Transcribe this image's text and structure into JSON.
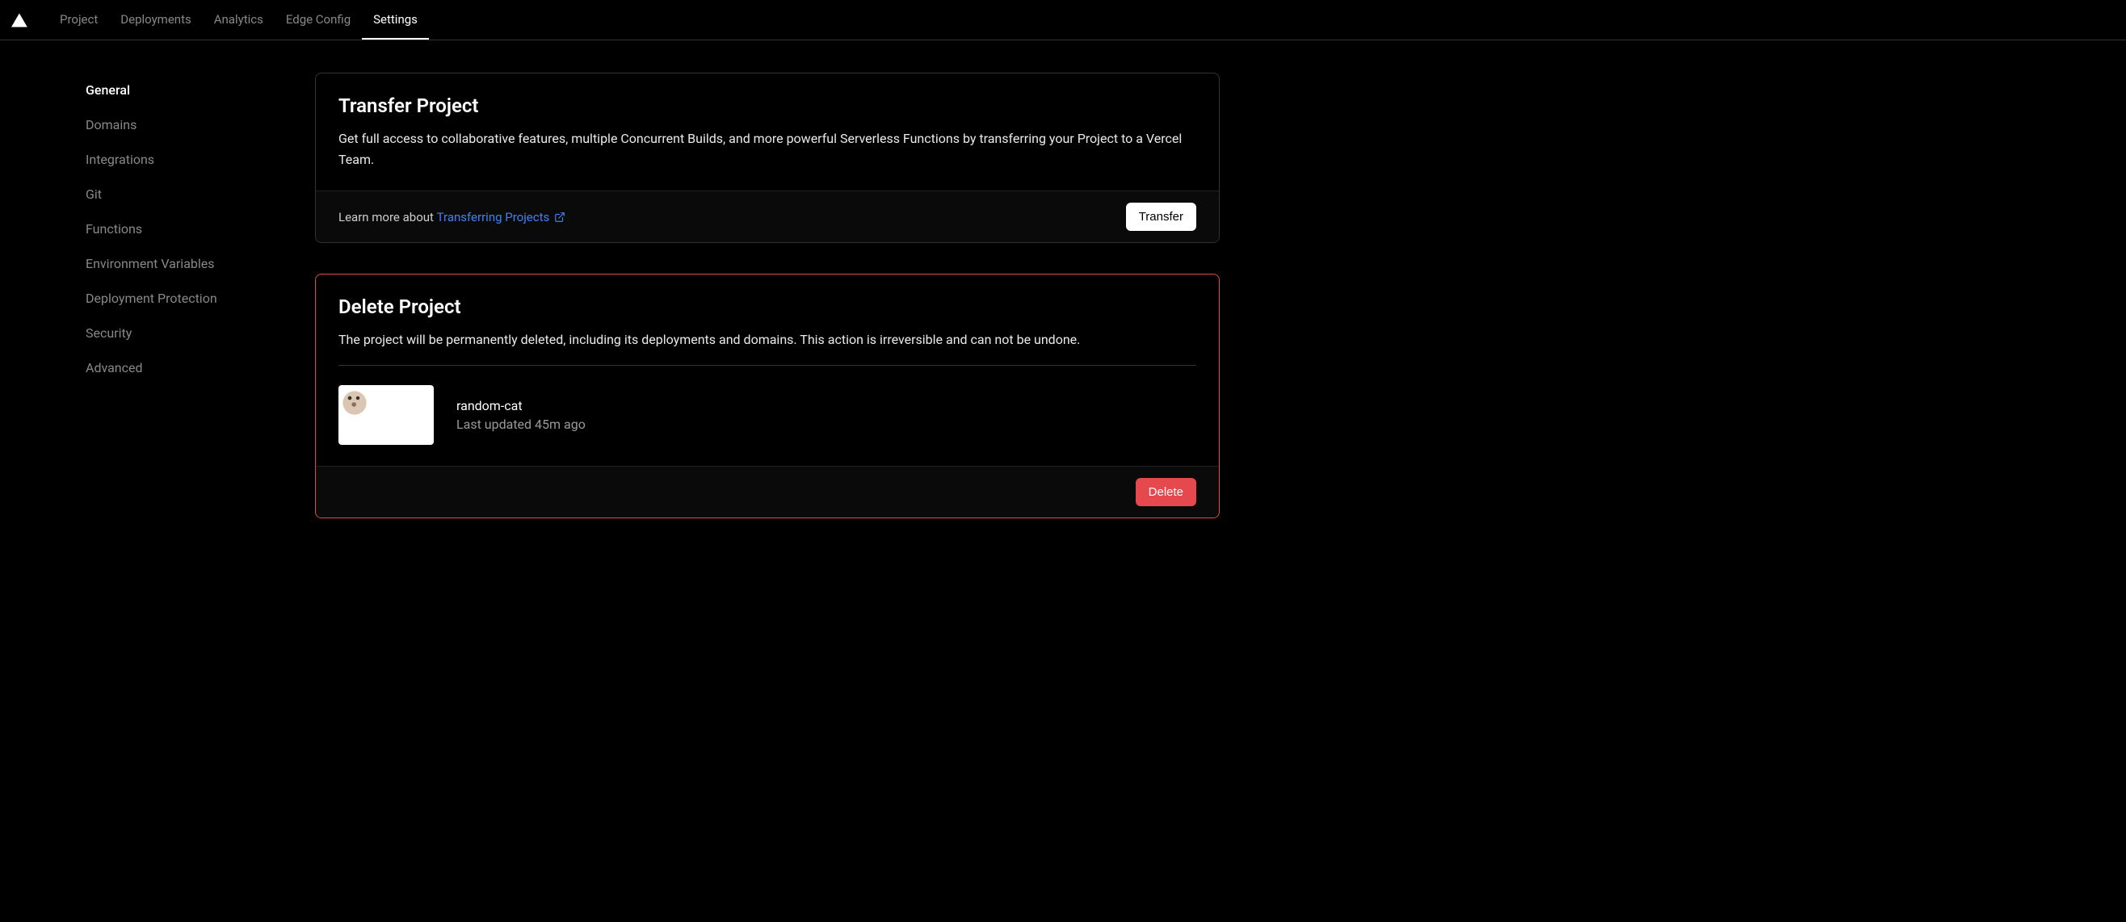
{
  "nav": {
    "tabs": [
      {
        "label": "Project",
        "active": false
      },
      {
        "label": "Deployments",
        "active": false
      },
      {
        "label": "Analytics",
        "active": false
      },
      {
        "label": "Edge Config",
        "active": false
      },
      {
        "label": "Settings",
        "active": true
      }
    ]
  },
  "sidebar": {
    "items": [
      {
        "label": "General",
        "active": true
      },
      {
        "label": "Domains",
        "active": false
      },
      {
        "label": "Integrations",
        "active": false
      },
      {
        "label": "Git",
        "active": false
      },
      {
        "label": "Functions",
        "active": false
      },
      {
        "label": "Environment Variables",
        "active": false
      },
      {
        "label": "Deployment Protection",
        "active": false
      },
      {
        "label": "Security",
        "active": false
      },
      {
        "label": "Advanced",
        "active": false
      }
    ]
  },
  "transfer_card": {
    "title": "Transfer Project",
    "description": "Get full access to collaborative features, multiple Concurrent Builds, and more powerful Serverless Functions by transferring your Project to a Vercel Team.",
    "footer_prefix": "Learn more about ",
    "link_text": "Transferring Projects",
    "button_label": "Transfer"
  },
  "delete_card": {
    "title": "Delete Project",
    "description": "The project will be permanently deleted, including its deployments and domains. This action is irreversible and can not be undone.",
    "project_name": "random-cat",
    "project_meta": "Last updated 45m ago",
    "button_label": "Delete"
  }
}
